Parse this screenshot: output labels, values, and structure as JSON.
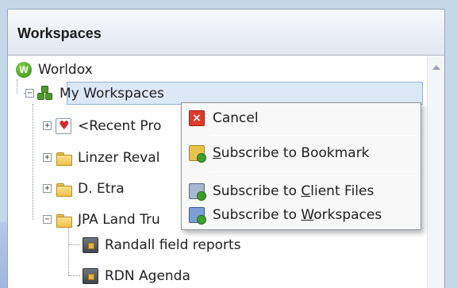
{
  "panel": {
    "title": "Workspaces"
  },
  "tree": {
    "root": {
      "label": "Worldox",
      "icon": "worldox-logo-icon"
    },
    "my_workspaces": {
      "label": "My Workspaces",
      "icon": "workspaces-icon"
    },
    "items": [
      {
        "label": "<Recent Pro",
        "icon": "favorites-heart-icon"
      },
      {
        "label": "Linzer Reval",
        "icon": "folder-icon"
      },
      {
        "label": "D. Etra",
        "icon": "folder-icon"
      },
      {
        "label": "JPA Land Tru",
        "icon": "folder-icon"
      }
    ],
    "children": [
      {
        "label": "Randall field reports",
        "icon": "file-cabinet-icon"
      },
      {
        "label": "RDN Agenda",
        "icon": "file-cabinet-icon"
      }
    ]
  },
  "context_menu": {
    "cancel": {
      "label": "Cancel",
      "icon": "cancel-icon"
    },
    "bookmark": {
      "pre": "",
      "mnemonic": "S",
      "post": "ubscribe to Bookmark",
      "icon": "subscribe-bookmark-icon"
    },
    "client_files": {
      "pre": "Subscribe to ",
      "mnemonic": "C",
      "post": "lient Files",
      "icon": "subscribe-client-files-icon"
    },
    "workspaces": {
      "pre": "Subscribe to ",
      "mnemonic": "W",
      "post": "orkspaces",
      "icon": "subscribe-workspaces-icon"
    }
  },
  "colors": {
    "selection": "#dde8f7",
    "header_bg": "#e2e8f1",
    "cancel_red": "#e03a2a"
  }
}
